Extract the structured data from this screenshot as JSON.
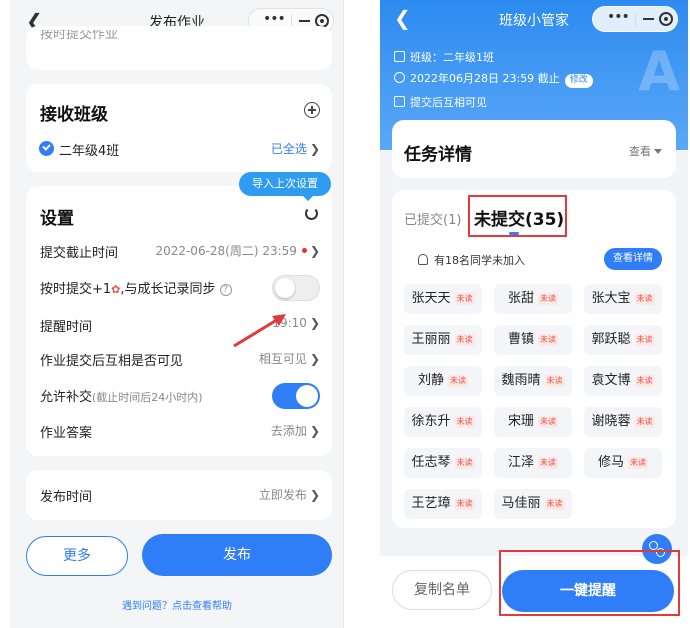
{
  "left": {
    "nav": {
      "title": "发布作业"
    },
    "top_faded_text": "按时提交作业",
    "receive": {
      "title": "接收班级",
      "class_name": "二年级4班",
      "select_all": "已全选"
    },
    "tooltip": "导入上次设置",
    "settings": {
      "title": "设置",
      "rows": [
        {
          "label": "提交截止时间",
          "value": "2022-06-28(周二) 23:59"
        },
        {
          "label": "按时提交+1",
          "label_suffix": ",与成长记录同步",
          "toggle": false
        },
        {
          "label": "提醒时间",
          "value": "19:10"
        },
        {
          "label": "作业提交后互相是否可见",
          "value": "相互可见"
        },
        {
          "label": "允许补交",
          "label_note": "(截止时间后24小时内)",
          "toggle": true
        },
        {
          "label": "作业答案",
          "value": "去添加"
        }
      ]
    },
    "publish_time": {
      "label": "发布时间",
      "value": "立即发布"
    },
    "buttons": {
      "more": "更多",
      "publish": "发布"
    },
    "help": "遇到问题？点击查看帮助"
  },
  "right": {
    "nav": {
      "title": "班级小管家"
    },
    "info": {
      "class_line": "班级：二年级1班",
      "deadline_line": "2022年06月28日 23:59 截止",
      "modify": "修改",
      "visibility_line": "提交后互相可见"
    },
    "task": {
      "title": "任务详情",
      "view": "查看"
    },
    "tabs": {
      "submitted": "已提交(1)",
      "unsubmitted": "未提交(35)"
    },
    "notice": "有18名同学未加入",
    "detail_button": "查看详情",
    "unread_tag": "未读",
    "students": [
      "张天天",
      "张甜",
      "张大宝",
      "王丽丽",
      "曹镇",
      "郭跃聪",
      "刘静",
      "魏雨晴",
      "袁文博",
      "徐东升",
      "宋珊",
      "谢晓蓉",
      "任志琴",
      "江泽",
      "修马",
      "王艺璋",
      "马佳丽"
    ],
    "buttons": {
      "copy": "复制名单",
      "remind": "一键提醒"
    }
  },
  "colors": {
    "accent": "#2f7ef7",
    "highlight": "#e03a3a",
    "unread": "#e8554a"
  }
}
